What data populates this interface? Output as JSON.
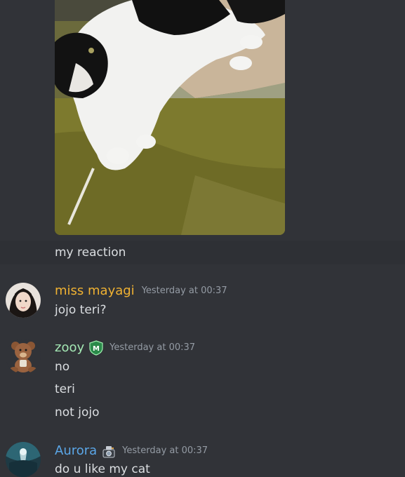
{
  "messages": {
    "reaction_text": "my reaction",
    "miss_mayagi": {
      "username": "miss mayagi",
      "username_color": "#f0b232",
      "timestamp": "Yesterday at 00:37",
      "lines": [
        "jojo teri?"
      ]
    },
    "zooy": {
      "username": "zooy",
      "username_color": "#a4e8b4",
      "timestamp": "Yesterday at 00:37",
      "badge_icon": "m-shield-badge-icon",
      "lines": [
        "no",
        "teri",
        "not jojo"
      ]
    },
    "aurora": {
      "username": "Aurora",
      "username_color": "#5ba7e8",
      "timestamp": "Yesterday at 00:37",
      "badge_icon": "camera-badge-icon",
      "lines": [
        "do u like my cat"
      ]
    }
  },
  "colors": {
    "background": "#313338",
    "hover_background": "#2e3035",
    "text": "#dbdee1",
    "timestamp": "#949ba4"
  }
}
